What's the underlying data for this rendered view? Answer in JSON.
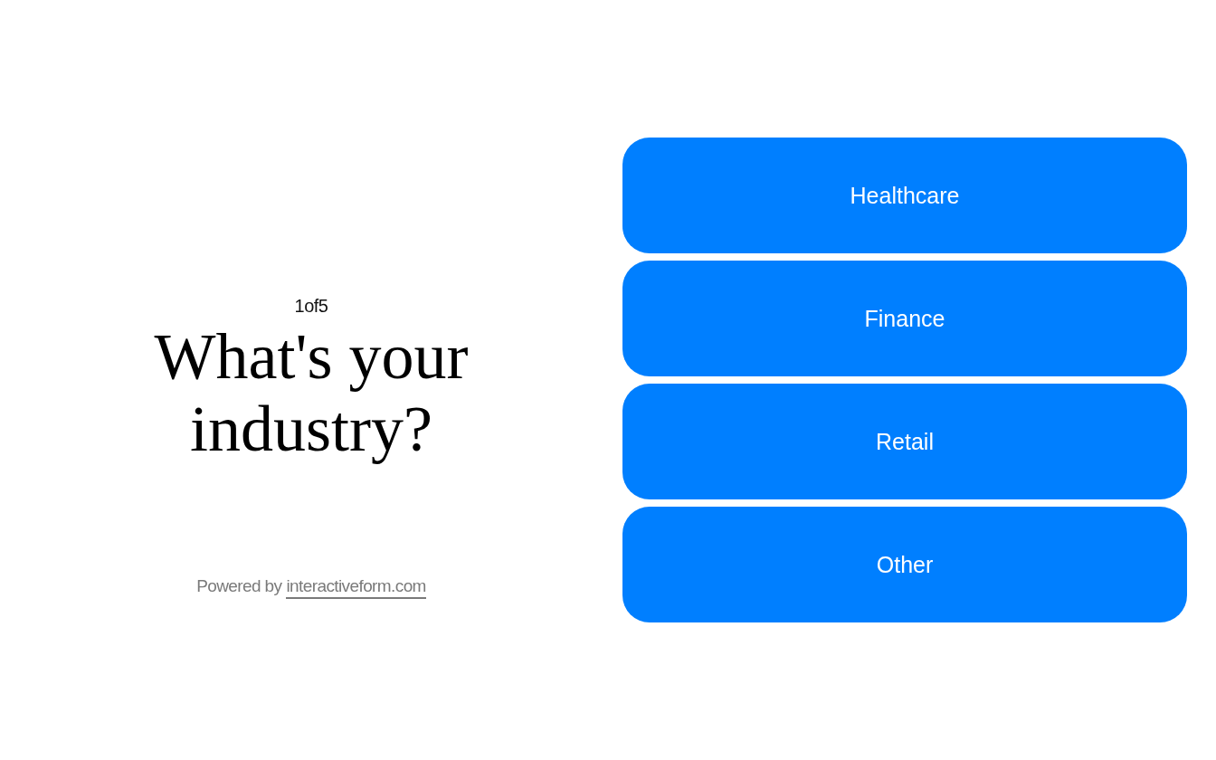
{
  "progress": {
    "counter": "1of5"
  },
  "question": {
    "title": "What's your industry?"
  },
  "options": [
    {
      "label": "Healthcare",
      "selected": false
    },
    {
      "label": "Finance",
      "selected": false
    },
    {
      "label": "Retail",
      "selected": false
    },
    {
      "label": "Other",
      "selected": false
    }
  ],
  "footer": {
    "label": "Powered by",
    "link": "interactiveform.com"
  }
}
